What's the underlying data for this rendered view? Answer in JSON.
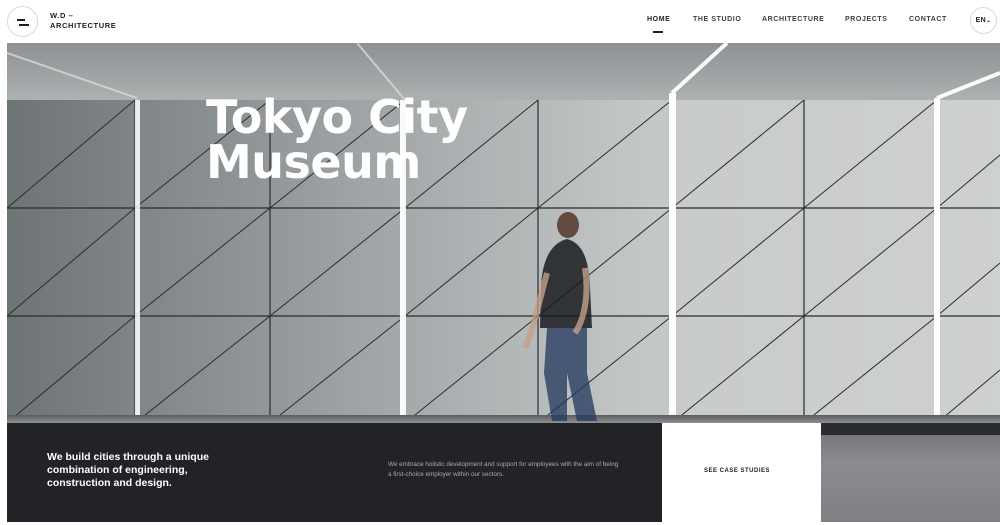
{
  "header": {
    "logo_line1": "W.D –",
    "logo_line2": "ARCHITECTURE",
    "nav": [
      {
        "label": "HOME",
        "active": true
      },
      {
        "label": "THE STUDIO",
        "active": false
      },
      {
        "label": "ARCHITECTURE",
        "active": false
      },
      {
        "label": "PROJECTS",
        "active": false
      },
      {
        "label": "CONTACT",
        "active": false
      }
    ],
    "lang": "EN",
    "menu_icon": "menu-icon",
    "lang_chevron_icon": "chevron-down-icon"
  },
  "hero": {
    "title_line1": "Tokyo City",
    "title_line2": "Museum"
  },
  "band": {
    "headline": "We build cities through a unique combination of engineering, construction and design.",
    "body": "We embrace holistic development and support for employees with the aim of being a first-choice employer within our sectors.",
    "cta": "SEE CASE STUDIES"
  },
  "colors": {
    "dark": "#222326",
    "text": "#1d1e20",
    "muted": "#a9abae",
    "wall": "#b9bdbe"
  }
}
